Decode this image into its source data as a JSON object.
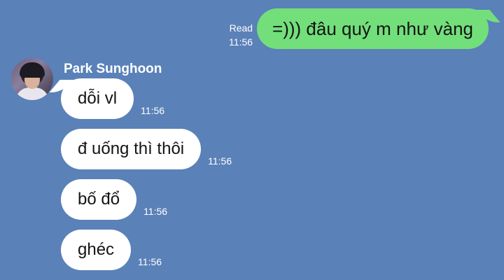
{
  "outgoing": {
    "read_label": "Read",
    "time": "11:56",
    "text": "=))) đâu quý m như vàng"
  },
  "incoming": {
    "sender": "Park Sunghoon",
    "messages": [
      {
        "text": "dỗi vl",
        "time": "11:56"
      },
      {
        "text": "đ uống thì thôi",
        "time": "11:56"
      },
      {
        "text": "bố đổ",
        "time": "11:56"
      },
      {
        "text": "ghéc",
        "time": "11:56"
      }
    ]
  },
  "colors": {
    "background": "#5a81b8",
    "outgoing_bubble": "#72df7b",
    "incoming_bubble": "#ffffff"
  }
}
